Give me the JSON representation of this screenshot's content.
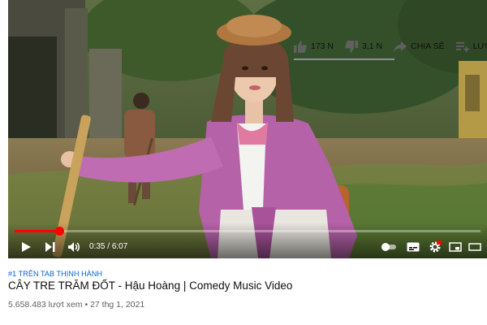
{
  "player": {
    "time_current": "0:35",
    "time_separator": " / ",
    "time_total": "6:07",
    "progress_fraction": 0.095
  },
  "video": {
    "tag": "#1 TRÊN TAB THỊNH HÀNH",
    "title": "CÂY TRE TRĂM ĐỐT - Hậu Hoàng | Comedy Music Video",
    "views": "5.658.483 lượt xem",
    "meta_separator": " • ",
    "date": "27 thg 1, 2021"
  },
  "actions": {
    "likes": "173 N",
    "dislikes": "3,1 N",
    "share_label": "CHIA SẺ",
    "save_label": "LƯU"
  },
  "colors": {
    "accent": "#ff0000",
    "link": "#065fd4",
    "text": "#0f0f0f",
    "secondary": "#606060"
  },
  "icons": [
    "play-icon",
    "next-icon",
    "volume-icon",
    "autoplay-toggle-icon",
    "subtitles-icon",
    "settings-icon",
    "miniplayer-icon",
    "theater-icon",
    "like-icon",
    "dislike-icon",
    "share-icon",
    "save-icon"
  ]
}
